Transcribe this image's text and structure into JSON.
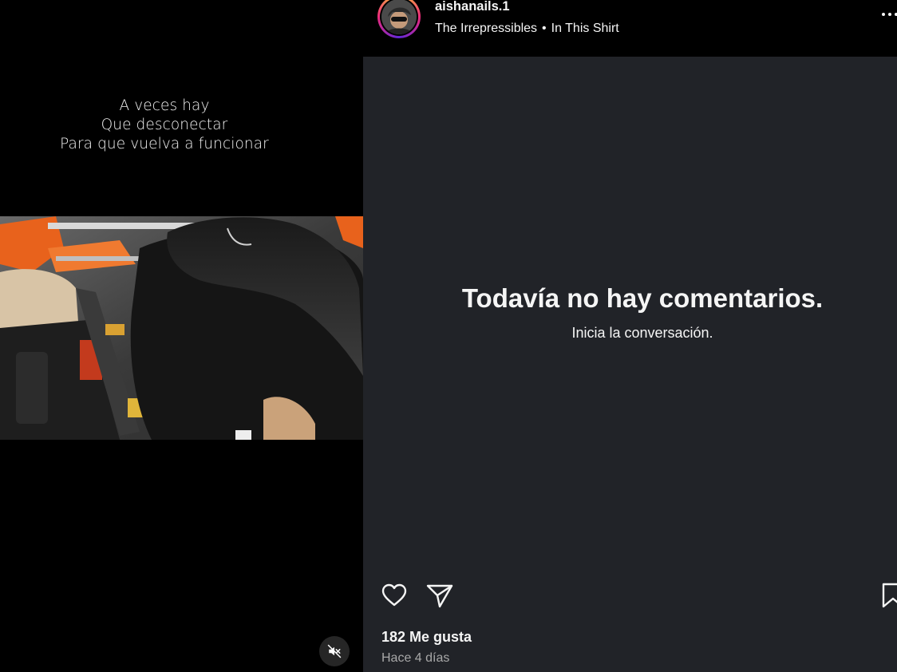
{
  "video": {
    "caption_lines": [
      "A veces hay",
      "Que desconectar",
      "Para que vuelva a funcionar"
    ],
    "mute_icon": "speaker-muted-icon"
  },
  "header": {
    "username": "aishanails.1",
    "audio_artist": "The Irrepressibles",
    "separator": "•",
    "audio_track": "In This Shirt",
    "more_icon": "more-options-icon"
  },
  "comments": {
    "empty_title": "Todavía no hay comentarios.",
    "empty_subtitle": "Inicia la conversación."
  },
  "actions": {
    "like_icon": "heart-icon",
    "share_icon": "paper-plane-icon",
    "save_icon": "bookmark-icon"
  },
  "stats": {
    "likes_label": "182 Me gusta",
    "timestamp": "Hace 4 días"
  },
  "colors": {
    "panel_bg": "#212328",
    "header_bg": "#000000",
    "text_primary": "#f5f5f5",
    "text_secondary": "#a8a8a8",
    "avatar_ring": [
      "#f9ce34",
      "#ee2a7b",
      "#6228d7"
    ]
  }
}
